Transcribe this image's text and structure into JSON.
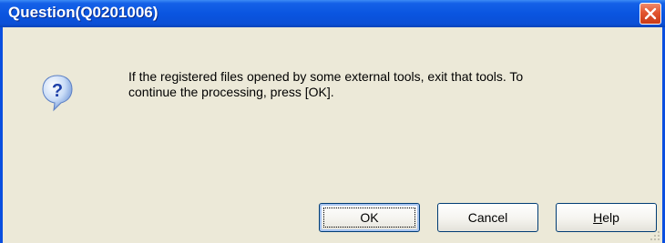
{
  "window": {
    "title": "Question(Q0201006)",
    "colors": {
      "titlebar": "#0a55e0",
      "client": "#ece9d8",
      "close": "#e2552f"
    }
  },
  "icons": {
    "close": "close-icon",
    "question": "question-icon",
    "grip": "resize-grip-icon"
  },
  "dialog": {
    "message_line1": "If the registered files opened by some external tools, exit that tools. To",
    "message_line2": "continue the processing, press [OK]."
  },
  "buttons": {
    "ok": "OK",
    "cancel": "Cancel",
    "help_mnemonic": "H",
    "help_rest": "elp"
  }
}
